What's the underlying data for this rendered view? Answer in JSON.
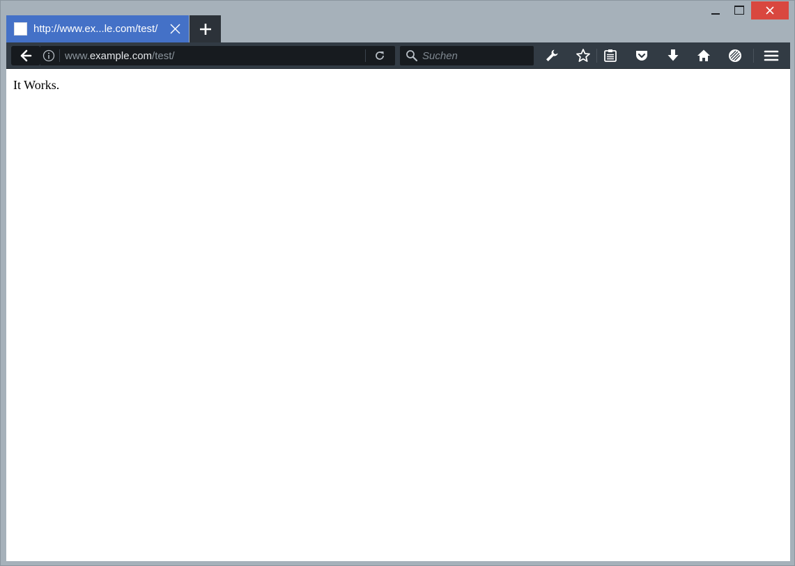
{
  "window": {
    "minimize_label": "",
    "maximize_label": "",
    "close_label": ""
  },
  "tab": {
    "title": "http://www.ex...le.com/test/"
  },
  "urlbar": {
    "prefix": "www.",
    "host": "example.com",
    "path": "/test/"
  },
  "search": {
    "placeholder": "Suchen",
    "value": ""
  },
  "page": {
    "text": "It Works."
  },
  "colors": {
    "tab_active": "#4471c7",
    "toolbar": "#323b44",
    "close_button": "#d9473f",
    "frame": "#a6b1ba"
  },
  "icons": {
    "back": "arrow-left-icon",
    "info": "info-icon",
    "reload": "reload-icon",
    "search": "search-icon",
    "developer": "wrench-icon",
    "bookmark": "star-icon",
    "bookmarks_menu": "bookmarks-list-icon",
    "pocket": "pocket-icon",
    "downloads": "download-arrow-icon",
    "home": "home-icon",
    "sync": "sync-icon",
    "menu": "hamburger-menu-icon"
  }
}
